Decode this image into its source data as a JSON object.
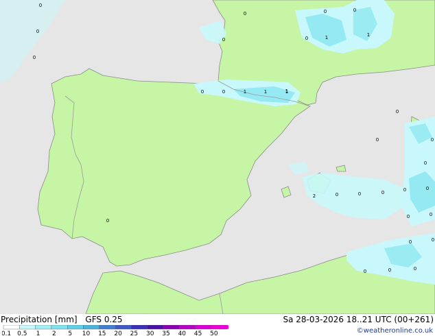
{
  "map_values": [
    "0",
    "0",
    "0",
    "0",
    "0",
    "0",
    "1",
    "1",
    "0",
    "1",
    "0",
    "1",
    "1",
    "1",
    "0",
    "0",
    "0",
    "0",
    "0",
    "0",
    "0",
    "0",
    "2",
    "0",
    "0",
    "0",
    "0",
    "0",
    "0",
    "0",
    "0",
    "0",
    "0",
    "0",
    "0",
    "0",
    "0",
    "0"
  ],
  "legend": {
    "title": "Precipitation [mm]",
    "model": "GFS 0.25",
    "ticks": [
      "0.1",
      "0.5",
      "1",
      "2",
      "5",
      "10",
      "15",
      "20",
      "25",
      "30",
      "35",
      "40",
      "45",
      "50"
    ],
    "colors": [
      "#fefefe",
      "#c8f8fb",
      "#a0eff4",
      "#7de3ee",
      "#5fd0e6",
      "#4cb4dc",
      "#4080d2",
      "#3c5ac8",
      "#3830b8",
      "#4a10a8",
      "#8a00b4",
      "#b800c8",
      "#dc00dc",
      "#f000d8"
    ]
  },
  "run_info": "Sa 28-03-2026 18..21 UTC (00+261)",
  "credit": "©weatheronline.co.uk",
  "colors": {
    "sea": "#e6e6e6",
    "land": "#c6f5a5",
    "border": "#9a9a9a",
    "precip_light": "#c8f8fb",
    "precip_mid": "#a0eff4"
  }
}
